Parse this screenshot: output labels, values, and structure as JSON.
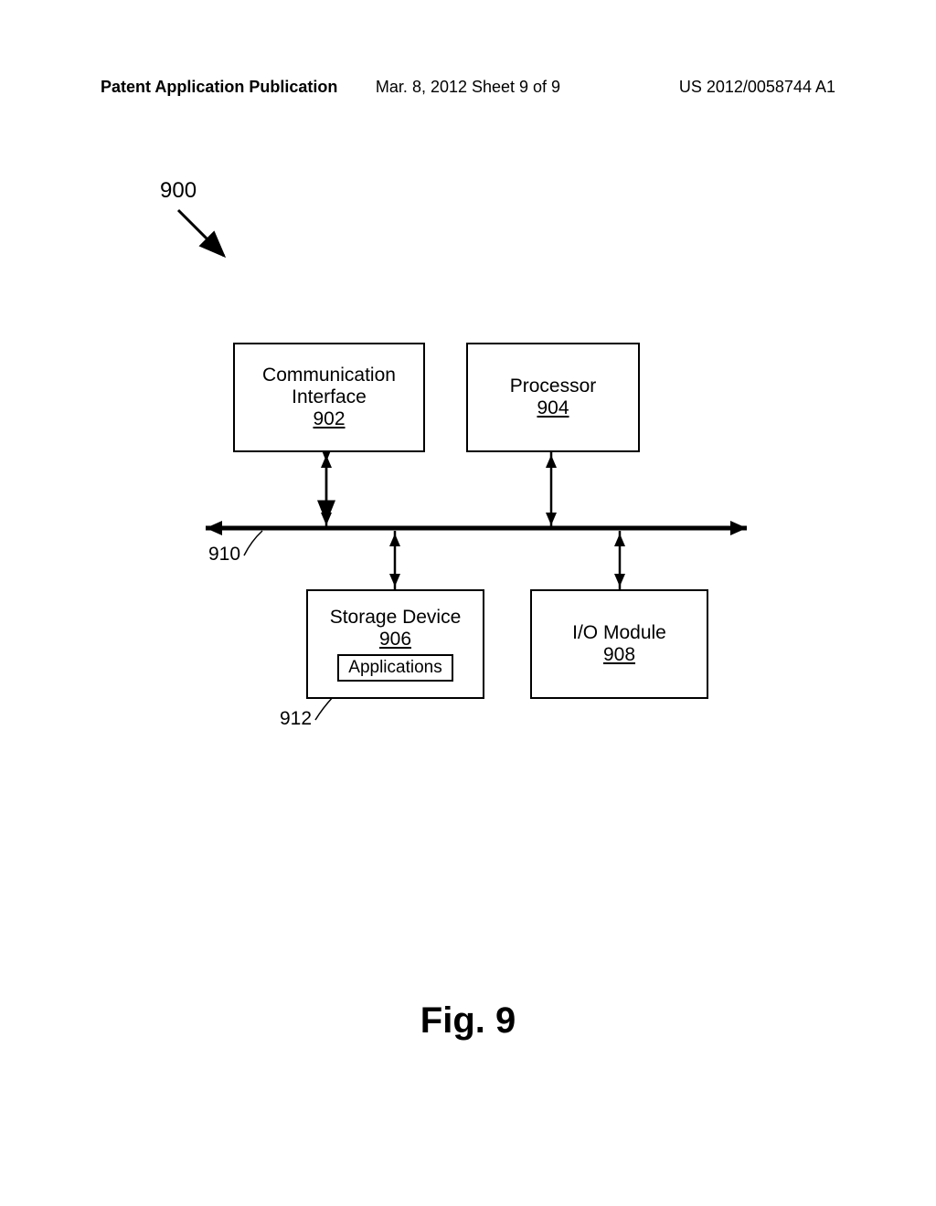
{
  "header": {
    "left": "Patent Application Publication",
    "center": "Mar. 8, 2012  Sheet 9 of 9",
    "right": "US 2012/0058744 A1"
  },
  "refs": {
    "r900": "900",
    "r910": "910",
    "r912": "912"
  },
  "boxes": {
    "comm": {
      "line1": "Communication",
      "line2": "Interface",
      "ref": "902"
    },
    "proc": {
      "line1": "Processor",
      "ref": "904"
    },
    "storage": {
      "line1": "Storage Device",
      "ref": "906",
      "inner": "Applications"
    },
    "io": {
      "line1": "I/O Module",
      "ref": "908"
    }
  },
  "figure": "Fig. 9"
}
